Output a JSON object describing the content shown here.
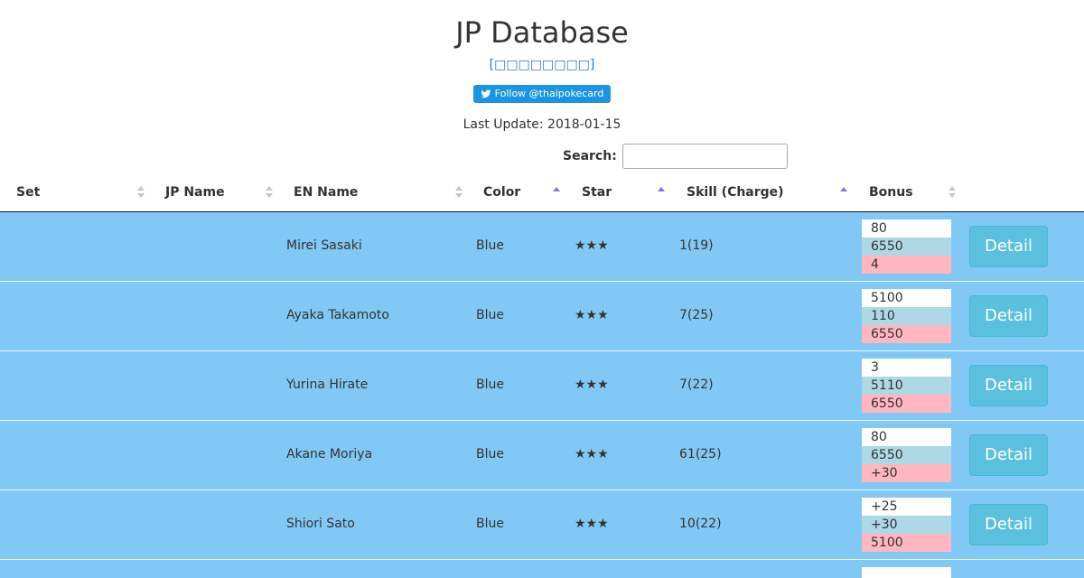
{
  "header": {
    "title": "JP Database",
    "jp_link": "[□□□□□□□□]",
    "follow_label": "Follow @thaipokecard",
    "last_update": "Last Update: 2018-01-15"
  },
  "search": {
    "label": "Search:",
    "value": "",
    "placeholder": ""
  },
  "columns": [
    {
      "key": "set",
      "label": "Set",
      "sort": "none"
    },
    {
      "key": "jp_name",
      "label": "JP Name",
      "sort": "none"
    },
    {
      "key": "en_name",
      "label": "EN Name",
      "sort": "none"
    },
    {
      "key": "color",
      "label": "Color",
      "sort": "asc"
    },
    {
      "key": "star",
      "label": "Star",
      "sort": "asc"
    },
    {
      "key": "skill",
      "label": "Skill (Charge)",
      "sort": "asc"
    },
    {
      "key": "bonus",
      "label": "Bonus",
      "sort": "none"
    }
  ],
  "detail_label": "Detail",
  "rows": [
    {
      "set": "",
      "jp_name": "",
      "en_name": "Mirei Sasaki",
      "color": "Blue",
      "star": "★★★",
      "skill": "1(19)",
      "bonus": [
        "80",
        "6550",
        "4"
      ]
    },
    {
      "set": "",
      "jp_name": "",
      "en_name": "Ayaka Takamoto",
      "color": "Blue",
      "star": "★★★",
      "skill": "7(25)",
      "bonus": [
        "5100",
        "110",
        "6550"
      ]
    },
    {
      "set": "",
      "jp_name": "",
      "en_name": "Yurina Hirate",
      "color": "Blue",
      "star": "★★★",
      "skill": "7(22)",
      "bonus": [
        "3",
        "5110",
        "6550"
      ]
    },
    {
      "set": "",
      "jp_name": "",
      "en_name": "Akane Moriya",
      "color": "Blue",
      "star": "★★★",
      "skill": "61(25)",
      "bonus": [
        "80",
        "6550",
        "+30"
      ]
    },
    {
      "set": "",
      "jp_name": "",
      "en_name": "Shiori Sato",
      "color": "Blue",
      "star": "★★★",
      "skill": "10(22)",
      "bonus": [
        "+25",
        "+30",
        "5100"
      ]
    }
  ],
  "colors": {
    "row_bg": "#82c8f5",
    "detail_btn": "#5bc0de",
    "twitter": "#1b95e0",
    "bonus_white": "#ffffff",
    "bonus_blue": "#add8e6",
    "bonus_pink": "#ffb6c1"
  }
}
